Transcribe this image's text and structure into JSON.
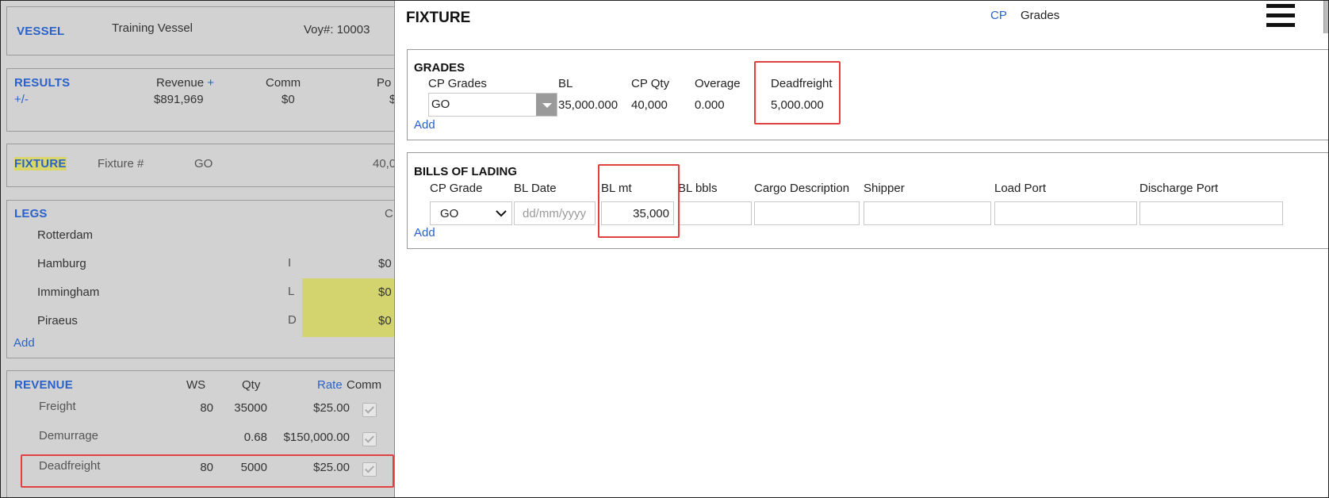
{
  "vessel": {
    "title": "VESSEL",
    "name": "Training Vessel",
    "voy": "Voy#: 10003"
  },
  "results": {
    "title": "RESULTS",
    "plusminus": "+/-",
    "revenue_label": "Revenue",
    "revenue_plus": "+",
    "comm_label": "Comm",
    "po_label": "Po",
    "revenue_value": "$891,969",
    "comm_value": "$0",
    "po_value": "$"
  },
  "fixture_card": {
    "title": "FIXTURE",
    "fixture_no_label": "Fixture #",
    "grade": "GO",
    "qty": "40,0"
  },
  "legs": {
    "title": "LEGS",
    "col": "C",
    "items": [
      {
        "port": "Rotterdam",
        "type": "",
        "amount": ""
      },
      {
        "port": "Hamburg",
        "type": "I",
        "amount": "$0"
      },
      {
        "port": "Immingham",
        "type": "L",
        "amount": "$0"
      },
      {
        "port": "Piraeus",
        "type": "D",
        "amount": "$0"
      }
    ],
    "add": "Add"
  },
  "revenue": {
    "title": "REVENUE",
    "headers": {
      "ws": "WS",
      "qty": "Qty",
      "rate": "Rate",
      "comm": "Comm"
    },
    "rows": [
      {
        "name": "Freight",
        "ws": "80",
        "qty": "35000",
        "rate": "$25.00"
      },
      {
        "name": "Demurrage",
        "ws": "",
        "qty": "0.68",
        "rate": "$150,000.00"
      },
      {
        "name": "Deadfreight",
        "ws": "80",
        "qty": "5000",
        "rate": "$25.00"
      }
    ]
  },
  "fixture_panel": {
    "title": "FIXTURE",
    "tabs": [
      "CP",
      "Grades"
    ],
    "grades": {
      "title": "GRADES",
      "headers": [
        "CP Grades",
        "BL",
        "CP Qty",
        "Overage",
        "Deadfreight"
      ],
      "row": {
        "grade": "GO",
        "bl": "35,000.000",
        "cp_qty": "40,000",
        "overage": "0.000",
        "deadfreight": "5,000.000"
      },
      "add": "Add"
    },
    "bills": {
      "title": "BILLS OF LADING",
      "headers": [
        "CP Grade",
        "BL Date",
        "BL mt",
        "BL bbls",
        "Cargo Description",
        "Shipper",
        "Load Port",
        "Discharge Port"
      ],
      "row": {
        "grade": "GO",
        "bl_date_placeholder": "dd/mm/yyyy",
        "bl_mt": "35,000"
      },
      "add": "Add"
    }
  },
  "colors": {
    "accent": "#2a62c9",
    "highlight_red": "#e04040",
    "highlight_yellow": "#d3d46e",
    "left_bg": "#d2d2d2"
  }
}
